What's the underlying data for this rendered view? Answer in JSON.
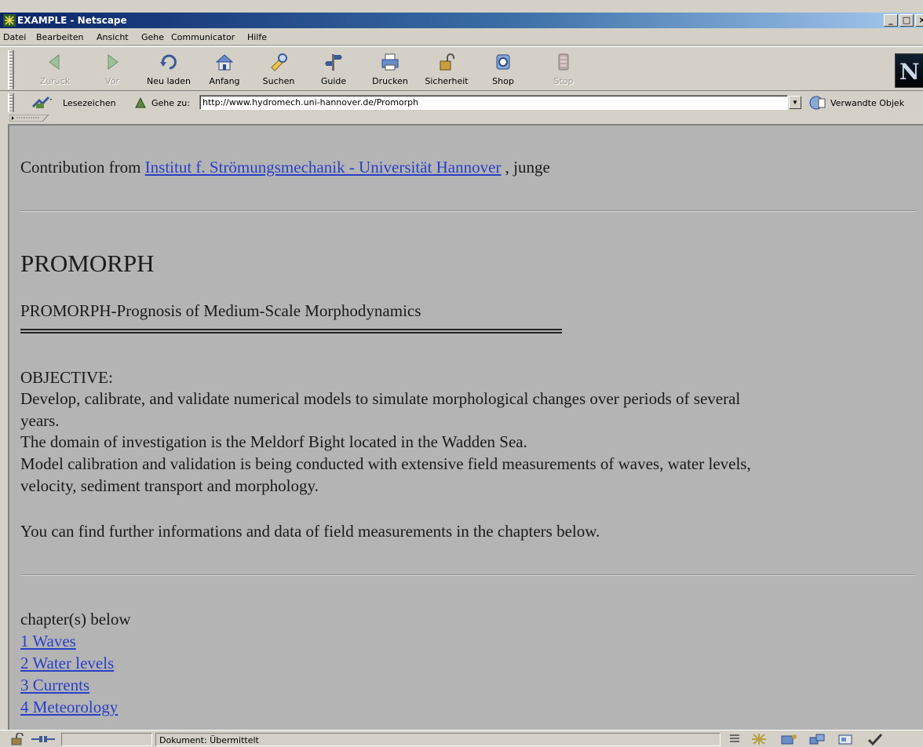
{
  "window": {
    "title": "EXAMPLE - Netscape",
    "caption_buttons": [
      "_",
      "□",
      "×"
    ]
  },
  "menu": [
    "Datei",
    "Bearbeiten",
    "Ansicht",
    "Gehe",
    "Communicator",
    "Hilfe"
  ],
  "toolbar": {
    "back": "Zurück",
    "forward": "Vor",
    "reload": "Neu laden",
    "home": "Anfang",
    "search": "Suchen",
    "guide": "Guide",
    "print": "Drucken",
    "security": "Sicherheit",
    "shop": "Shop",
    "stop": "Stop",
    "logo": "N"
  },
  "location": {
    "bookmarks_label": "Lesezeichen",
    "goto_label": "Gehe zu:",
    "url": "http://www.hydromech.uni-hannover.de/Promorph",
    "related_label": "Verwandte Objek"
  },
  "page": {
    "contribution_prefix": "Contribution from",
    "contribution_link": "Institut f. Strömungsmechanik - Universität Hannover",
    "contribution_suffix": ", junge",
    "heading": "PROMORPH",
    "subtitle": "PROMORPH-Prognosis of Medium-Scale Morphodynamics",
    "objective_label": "OBJECTIVE:",
    "objective_line1": "Develop, calibrate, and validate numerical models to simulate morphological changes over periods of several",
    "objective_line2": "years.",
    "domain_line": "The domain of investigation is the Meldorf Bight located in the Wadden Sea.",
    "calibration_line1": "Model calibration and validation is being conducted with extensive field measurements of waves, water levels,",
    "calibration_line2": "velocity, sediment transport and morphology.",
    "further_info": "You can find further informations and data of field measurements in the chapters below.",
    "chapters_label": "chapter(s) below",
    "chapters": [
      "1 Waves",
      "2 Water levels",
      "3 Currents",
      "4 Meteorology"
    ]
  },
  "status": {
    "text": "Dokument: Übermittelt"
  },
  "colors": {
    "page_background": "#b4b4b4",
    "link": "#2a3fc8",
    "chrome": "#d4d0c8",
    "title_bar": "#0a246a"
  }
}
